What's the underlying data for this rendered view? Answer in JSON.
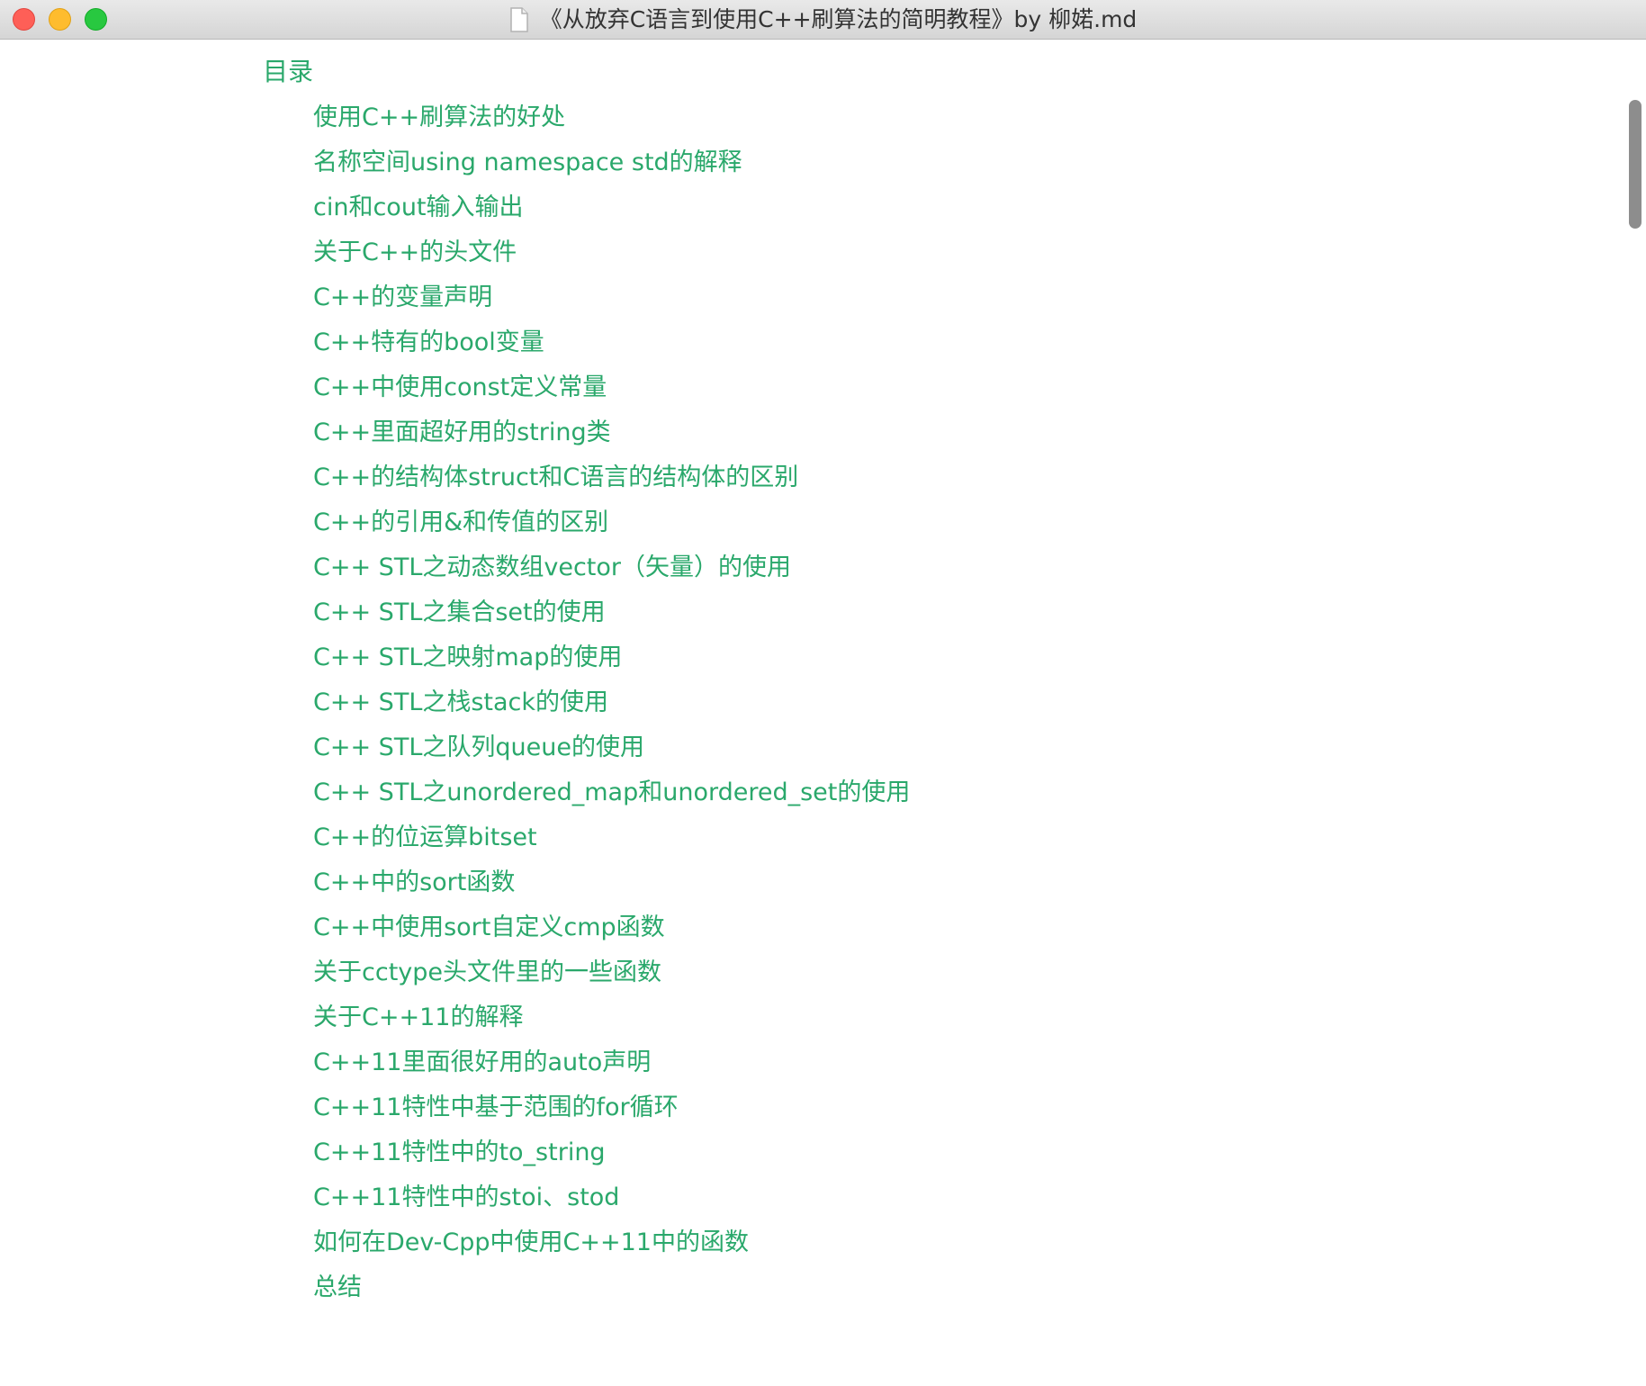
{
  "window": {
    "title": "《从放弃C语言到使用C++刷算法的简明教程》by 柳婼.md"
  },
  "toc": {
    "heading": "目录",
    "items": [
      "使用C++刷算法的好处",
      "名称空间using namespace std的解释",
      "cin和cout输入输出",
      "关于C++的头文件",
      "C++的变量声明",
      "C++特有的bool变量",
      "C++中使用const定义常量",
      "C++里面超好用的string类",
      "C++的结构体struct和C语言的结构体的区别",
      "C++的引用&和传值的区别",
      "C++ STL之动态数组vector（矢量）的使用",
      "C++ STL之集合set的使用",
      "C++ STL之映射map的使用",
      "C++ STL之栈stack的使用",
      "C++ STL之队列queue的使用",
      "C++ STL之unordered_map和unordered_set的使用",
      "C++的位运算bitset",
      "C++中的sort函数",
      "C++中使用sort自定义cmp函数",
      "关于cctype头文件里的一些函数",
      "关于C++11的解释",
      "C++11里面很好用的auto声明",
      "C++11特性中基于范围的for循环",
      "C++11特性中的to_string",
      "C++11特性中的stoi、stod",
      "如何在Dev-Cpp中使用C++11中的函数",
      "总结"
    ]
  },
  "colors": {
    "link": "#2aa86b",
    "close": "#fe5f57",
    "minimize": "#febc2e",
    "zoom": "#28c840"
  },
  "icons": {
    "document": "document-icon",
    "close": "close-icon",
    "minimize": "minimize-icon",
    "zoom": "zoom-icon"
  }
}
